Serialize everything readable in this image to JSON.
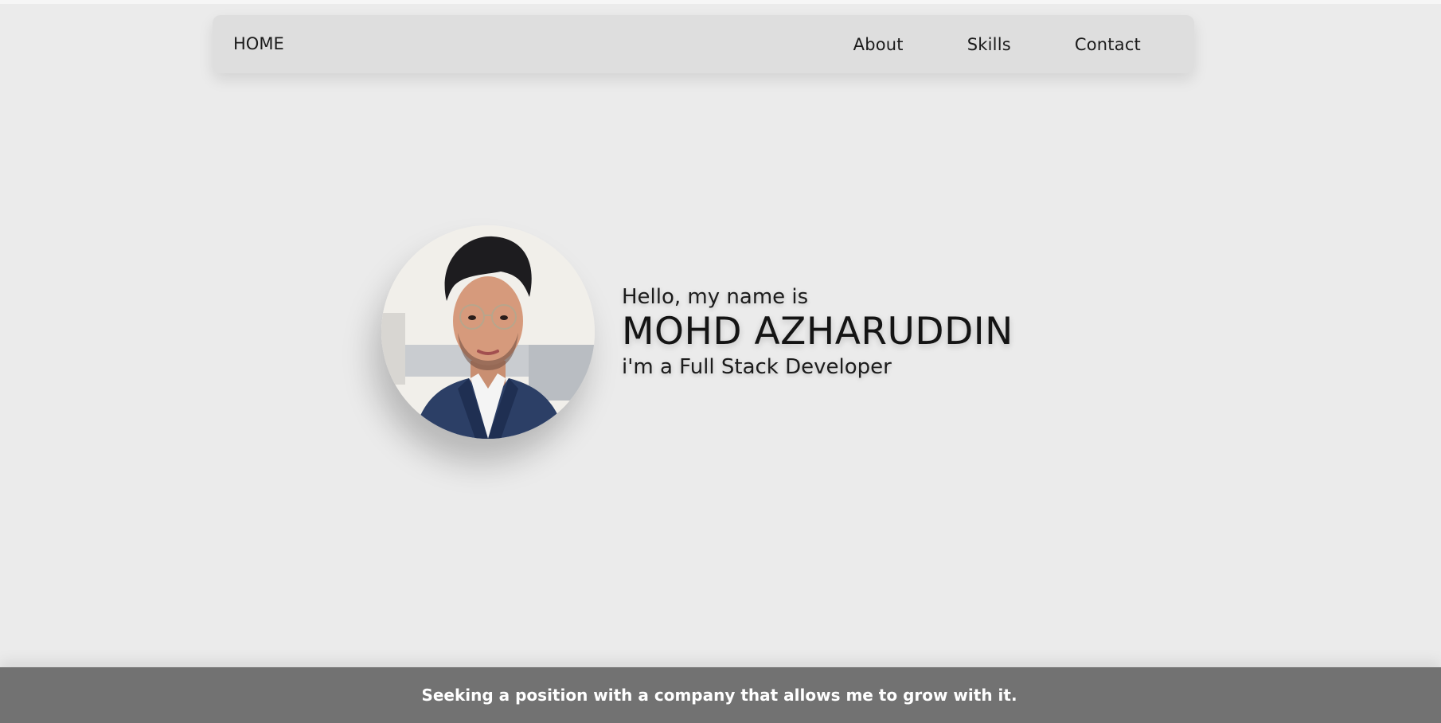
{
  "nav": {
    "home_label": "HOME",
    "links": [
      {
        "label": "About"
      },
      {
        "label": "Skills"
      },
      {
        "label": "Contact"
      }
    ]
  },
  "hero": {
    "greeting": "Hello, my name is",
    "name": "MOHD AZHARUDDIN",
    "role": "i'm a Full Stack Developer",
    "avatar": "profile-photo"
  },
  "footer": {
    "text": "Seeking a position with a company that allows me to grow with it."
  },
  "colors": {
    "background": "#ebebeb",
    "navbar": "#dedede",
    "footer": "#727272",
    "text": "#111111"
  }
}
